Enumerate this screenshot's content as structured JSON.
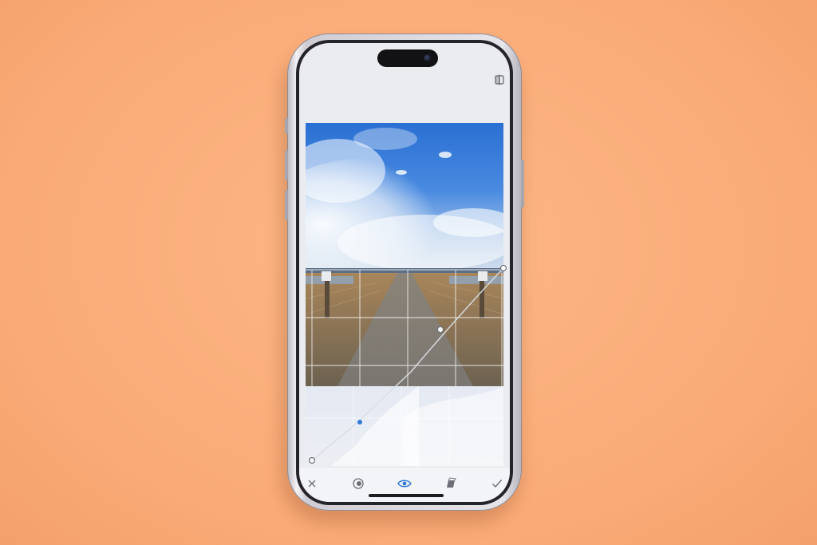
{
  "device": "iPhone",
  "app": {
    "mode": "Curves",
    "compare_icon": "compare-split-icon",
    "toolbar": [
      {
        "name": "cancel",
        "icon": "close-icon"
      },
      {
        "name": "presets",
        "icon": "presets-icon"
      },
      {
        "name": "view",
        "icon": "eye-icon",
        "active": true
      },
      {
        "name": "channels",
        "icon": "layers-icon"
      },
      {
        "name": "apply",
        "icon": "check-icon"
      }
    ]
  },
  "colors": {
    "background": "#fbb07e",
    "accent": "#2f7ad8",
    "ui_icons": "#6b6e76"
  }
}
